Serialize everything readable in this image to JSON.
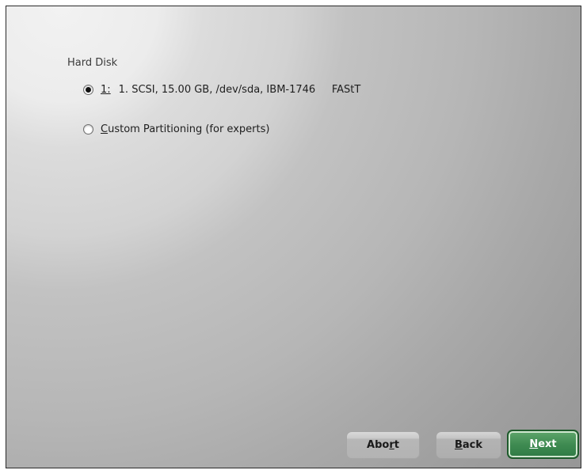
{
  "section": {
    "label": "Hard Disk"
  },
  "options": [
    {
      "number": "1:",
      "text": "1. SCSI, 15.00 GB, /dev/sda, IBM-1746     FAStT",
      "checked": true
    },
    {
      "mnemonic": "C",
      "rest": "ustom Partitioning (for experts)",
      "checked": false
    }
  ],
  "buttons": {
    "abort": {
      "pre": "Abo",
      "mnemonic": "r",
      "post": "t"
    },
    "back": {
      "mnemonic": "B",
      "post": "ack"
    },
    "next": {
      "mnemonic": "N",
      "post": "ext"
    }
  },
  "colors": {
    "next_button": "#3f8b52",
    "next_border": "#1f5a2c"
  }
}
